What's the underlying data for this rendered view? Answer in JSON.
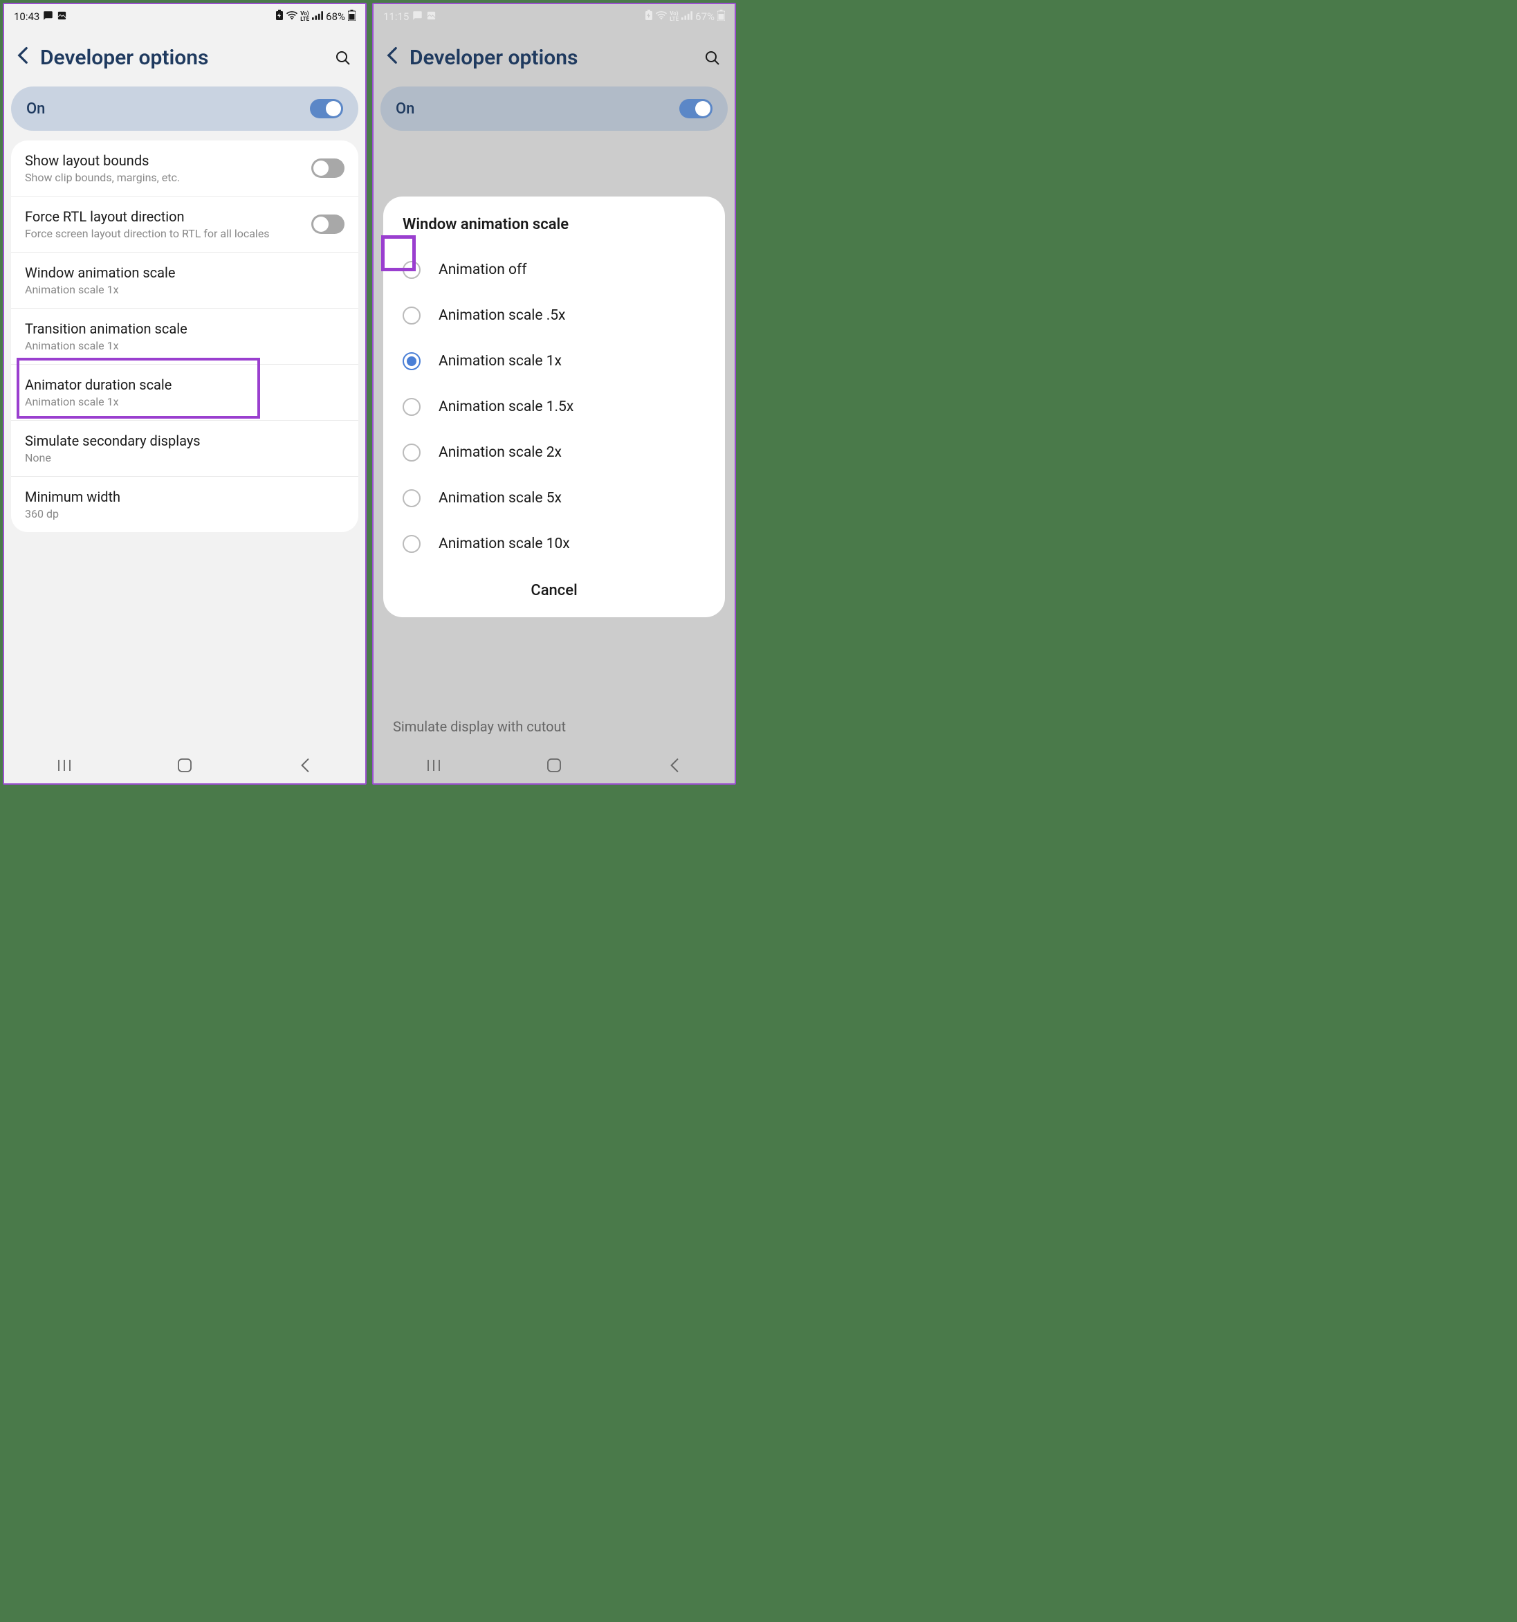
{
  "left": {
    "status": {
      "time": "10:43",
      "battery": "68%"
    },
    "header": {
      "title": "Developer options"
    },
    "on_pill": {
      "label": "On"
    },
    "rows": [
      {
        "title": "Show layout bounds",
        "sub": "Show clip bounds, margins, etc.",
        "toggle": true,
        "on": false
      },
      {
        "title": "Force RTL layout direction",
        "sub": "Force screen layout direction to RTL for all locales",
        "toggle": true,
        "on": false
      },
      {
        "title": "Window animation scale",
        "sub": "Animation scale 1x"
      },
      {
        "title": "Transition animation scale",
        "sub": "Animation scale 1x"
      },
      {
        "title": "Animator duration scale",
        "sub": "Animation scale 1x"
      },
      {
        "title": "Simulate secondary displays",
        "sub": "None"
      },
      {
        "title": "Minimum width",
        "sub": "360 dp"
      }
    ],
    "highlight_row_index": 2
  },
  "right": {
    "status": {
      "time": "11:15",
      "battery": "67%"
    },
    "header": {
      "title": "Developer options"
    },
    "on_pill": {
      "label": "On"
    },
    "bg_peek": "Simulate display with cutout",
    "dialog": {
      "title": "Window animation scale",
      "options": [
        "Animation off",
        "Animation scale .5x",
        "Animation scale 1x",
        "Animation scale 1.5x",
        "Animation scale 2x",
        "Animation scale 5x",
        "Animation scale 10x"
      ],
      "selected_index": 2,
      "highlight_index": 0,
      "cancel": "Cancel"
    }
  }
}
